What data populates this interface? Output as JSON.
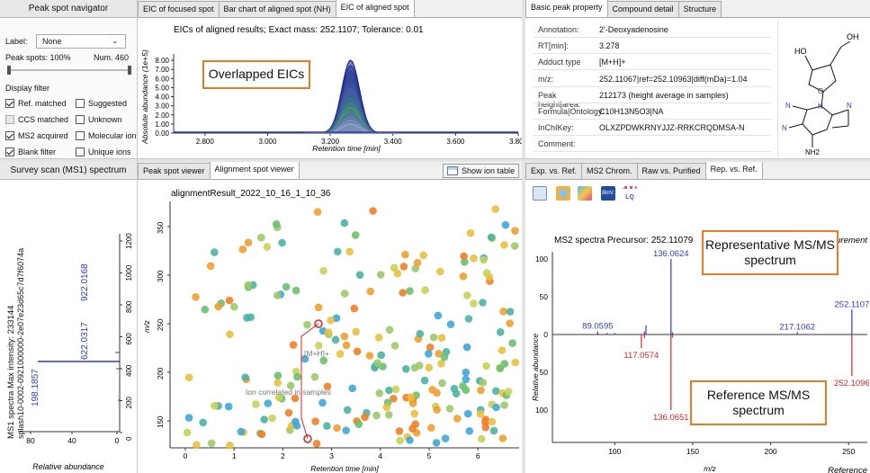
{
  "navigator": {
    "title": "Peak spot navigator",
    "label_caption": "Label:",
    "label_value": "None",
    "peak_spots": "Peak spots: 100%",
    "num": "Num. 460",
    "display_filter": "Display filter",
    "filters": [
      {
        "label": "Ref. matched",
        "checked": true,
        "disabled": false
      },
      {
        "label": "Suggested",
        "checked": false,
        "disabled": false
      },
      {
        "label": "CCS matched",
        "checked": false,
        "disabled": true
      },
      {
        "label": "Unknown",
        "checked": false,
        "disabled": false
      },
      {
        "label": "MS2 acquired",
        "checked": true,
        "disabled": false
      },
      {
        "label": "Molecular ion",
        "checked": false,
        "disabled": false
      },
      {
        "label": "Blank filter",
        "checked": true,
        "disabled": false
      },
      {
        "label": "Unique ions",
        "checked": false,
        "disabled": false
      }
    ]
  },
  "eic": {
    "tabs": [
      "EIC of focused spot",
      "Bar chart of aligned spot (NH)",
      "EIC of aligned spot"
    ],
    "active_tab": 2,
    "title": "EICs of aligned results; Exact mass: 252.1107; Tolerance: 0.01",
    "annotation": "Overlapped EICs"
  },
  "property": {
    "tabs": [
      "Basic peak property",
      "Compound detail",
      "Structure"
    ],
    "active_tab": 0,
    "rows": [
      {
        "key": "Annotation:",
        "value": "2'-Deoxyadenosine"
      },
      {
        "key": "RT[min]:",
        "value": "3.278"
      },
      {
        "key": "Adduct type",
        "value": "[M+H]+"
      },
      {
        "key": "m/z:",
        "value": "252.11067|ref=252.10963|diff(mDa)=1.04"
      },
      {
        "key": "Peak height|area:",
        "value": "212173 (height average in samples)"
      },
      {
        "key": "Formula|Ontology:",
        "value": "C10H13N5O3|NA"
      },
      {
        "key": "InChIKey:",
        "value": "OLXZPDWKRNYJJZ-RRKCRQDMSA-N"
      },
      {
        "key": "Comment:",
        "value": ""
      }
    ],
    "structure_labels": {
      "ho": "HO",
      "oh": "OH",
      "nh2": "NH2"
    }
  },
  "survey": {
    "title": "Survey scan (MS1) spectrum",
    "ylabel_line1": "MS1 spectra Max intensity: 233144",
    "ylabel_line2": "splash10-0002-0921000000-2e07e23d65c7d7f6074a",
    "xlabel": "Relative abundance",
    "peak_labels": [
      "922.0168",
      "622.0317",
      "198.1857"
    ],
    "x_ticks": [
      "80",
      "40",
      "0"
    ],
    "y_ticks": [
      "1200",
      "1000",
      "800",
      "600",
      "400",
      "200",
      "0"
    ]
  },
  "viewer": {
    "tabs": [
      "Peak spot viewer",
      "Alignment spot viewer"
    ],
    "active_tab": 1,
    "show_ion_table": "Show ion table",
    "title": "alignmentResult_2022_10_16_1_10_36",
    "xlabel": "Retention time [min]",
    "ylabel": "m/z",
    "label_mh": "[M+H]+",
    "label_corr": "Ion correlated in samples",
    "x_ticks": [
      "0",
      "1",
      "2",
      "3",
      "4",
      "5",
      "6"
    ],
    "y_ticks": [
      "150",
      "200",
      "250",
      "300",
      "350"
    ]
  },
  "ms2": {
    "tabs": [
      "Exp. vs. Ref.",
      "MS2 Chrom.",
      "Raw vs. Purified",
      "Rep. vs. Ref."
    ],
    "active_tab": 3,
    "toolbar_icons": [
      "view-icon",
      "cube-icon",
      "molecule-icon",
      "binvestigate-icon",
      "lipidquery-icon"
    ],
    "toolbar_text": {
      "binv": "BinV.",
      "lq": "LQ"
    },
    "title": "MS2 spectra Precursor: 252.11079",
    "measurement": "Measurement",
    "reference": "Reference",
    "xlabel": "m/z",
    "ylabel": "Relative abundance",
    "rep_box": "Representative MS/MS spectrum",
    "ref_box": "Reference MS/MS spectrum",
    "x_ticks": [
      "100",
      "150",
      "200",
      "250"
    ],
    "y_ticks_top": [
      "100",
      "50",
      "0"
    ],
    "y_ticks_bottom": [
      "50",
      "100"
    ],
    "colors": {
      "measurement": "#2a3bd6",
      "reference": "#e0262b"
    }
  },
  "chart_data": [
    {
      "type": "line",
      "title": "EICs of aligned results; Exact mass: 252.1107; Tolerance: 0.01",
      "xlabel": "Retention time [min]",
      "ylabel": "Absolute abundance (1e+5)",
      "xlim": [
        2.7,
        3.8
      ],
      "ylim": [
        0,
        8.5
      ],
      "x_ticks": [
        "2.800",
        "3.000",
        "3.200",
        "3.400",
        "3.600",
        "3.800"
      ],
      "y_ticks": [
        "0.00",
        "1.00",
        "2.00",
        "3.00",
        "4.00",
        "5.00",
        "6.00",
        "7.00",
        "8.00"
      ],
      "peak_center": 3.265,
      "series_peak_heights": [
        8.0,
        7.4,
        6.8,
        6.1,
        5.5,
        4.9,
        4.3,
        3.8,
        3.3,
        2.8,
        2.3,
        1.8,
        1.4,
        1.0
      ]
    },
    {
      "type": "bar",
      "title": "MS2 spectra Precursor: 252.11079",
      "xlabel": "m/z",
      "ylabel": "Relative abundance",
      "xlim": [
        60,
        262
      ],
      "ylim": [
        -100,
        100
      ],
      "series": [
        {
          "name": "Measurement",
          "peaks": [
            [
              89.0595,
              4
            ],
            [
              95.0,
              2
            ],
            [
              100.0,
              2
            ],
            [
              119.0,
              4
            ],
            [
              120.0,
              12
            ],
            [
              136.0624,
              100
            ],
            [
              137.0,
              3
            ],
            [
              217.1062,
              3
            ],
            [
              252.1107,
              33
            ]
          ]
        },
        {
          "name": "Reference",
          "peaks": [
            [
              117.0574,
              -18
            ],
            [
              119.0,
              -5
            ],
            [
              136.0651,
              -100
            ],
            [
              137.0,
              -4
            ],
            [
              252.1096,
              -55
            ]
          ]
        }
      ]
    }
  ]
}
